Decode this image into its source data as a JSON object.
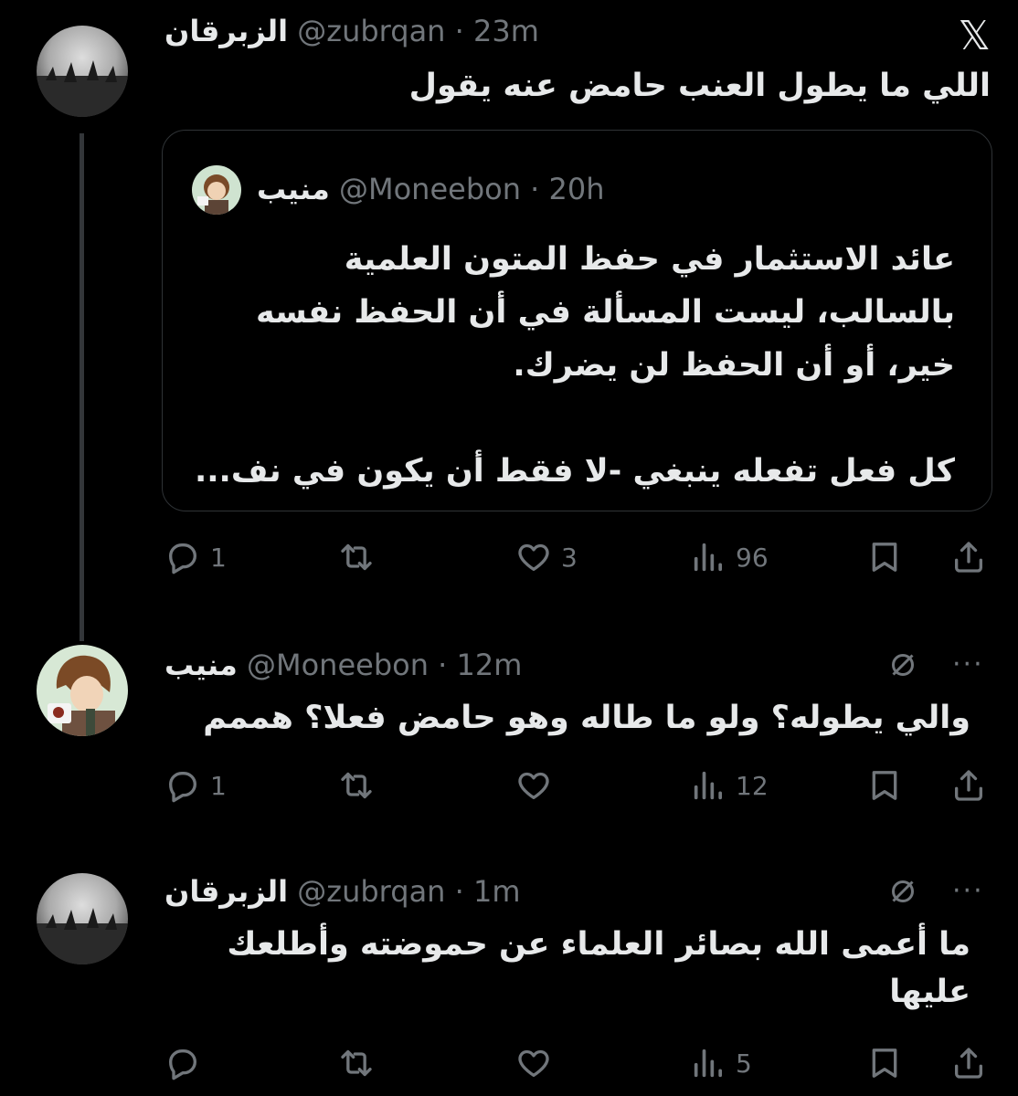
{
  "app": {
    "logo": "x-logo"
  },
  "tweets": [
    {
      "name": "الزبرقان",
      "handle": "@zubrqan",
      "separator": "·",
      "time": "23m",
      "text": "اللي ما يطول العنب حامض عنه يقول",
      "quote": {
        "name": "منيب",
        "handle": "@Moneebon",
        "separator": "·",
        "time": "20h",
        "text": "عائد الاستثمار في حفظ المتون العلمية\nبالسالب، ليست المسألة في أن الحفظ نفسه\nخير، أو أن الحفظ لن يضرك.\n\nكل فعل تفعله ينبغي -لا فقط أن يكون في نف..."
      },
      "stats": {
        "replies": "1",
        "reposts": "",
        "likes": "3",
        "views": "96"
      }
    },
    {
      "name": "منيب",
      "handle": "@Moneebon",
      "separator": "·",
      "time": "12m",
      "text": "والي يطوله؟ ولو ما طاله وهو حامض فعلا؟ هممم",
      "stats": {
        "replies": "1",
        "reposts": "",
        "likes": "",
        "views": "12"
      }
    },
    {
      "name": "الزبرقان",
      "handle": "@zubrqan",
      "separator": "·",
      "time": "1m",
      "text": "ما أعمى الله بصائر العلماء عن حموضته وأطلعك\nعليها",
      "stats": {
        "replies": "",
        "reposts": "",
        "likes": "",
        "views": "5"
      }
    }
  ],
  "colors": {
    "background": "#000000",
    "text": "#e7e9ea",
    "muted": "#71767b",
    "border": "#2f3336",
    "line": "#333639"
  },
  "icons": [
    "reply-icon",
    "repost-icon",
    "like-icon",
    "views-icon",
    "bookmark-icon",
    "share-icon",
    "grok-icon",
    "more-icon"
  ]
}
